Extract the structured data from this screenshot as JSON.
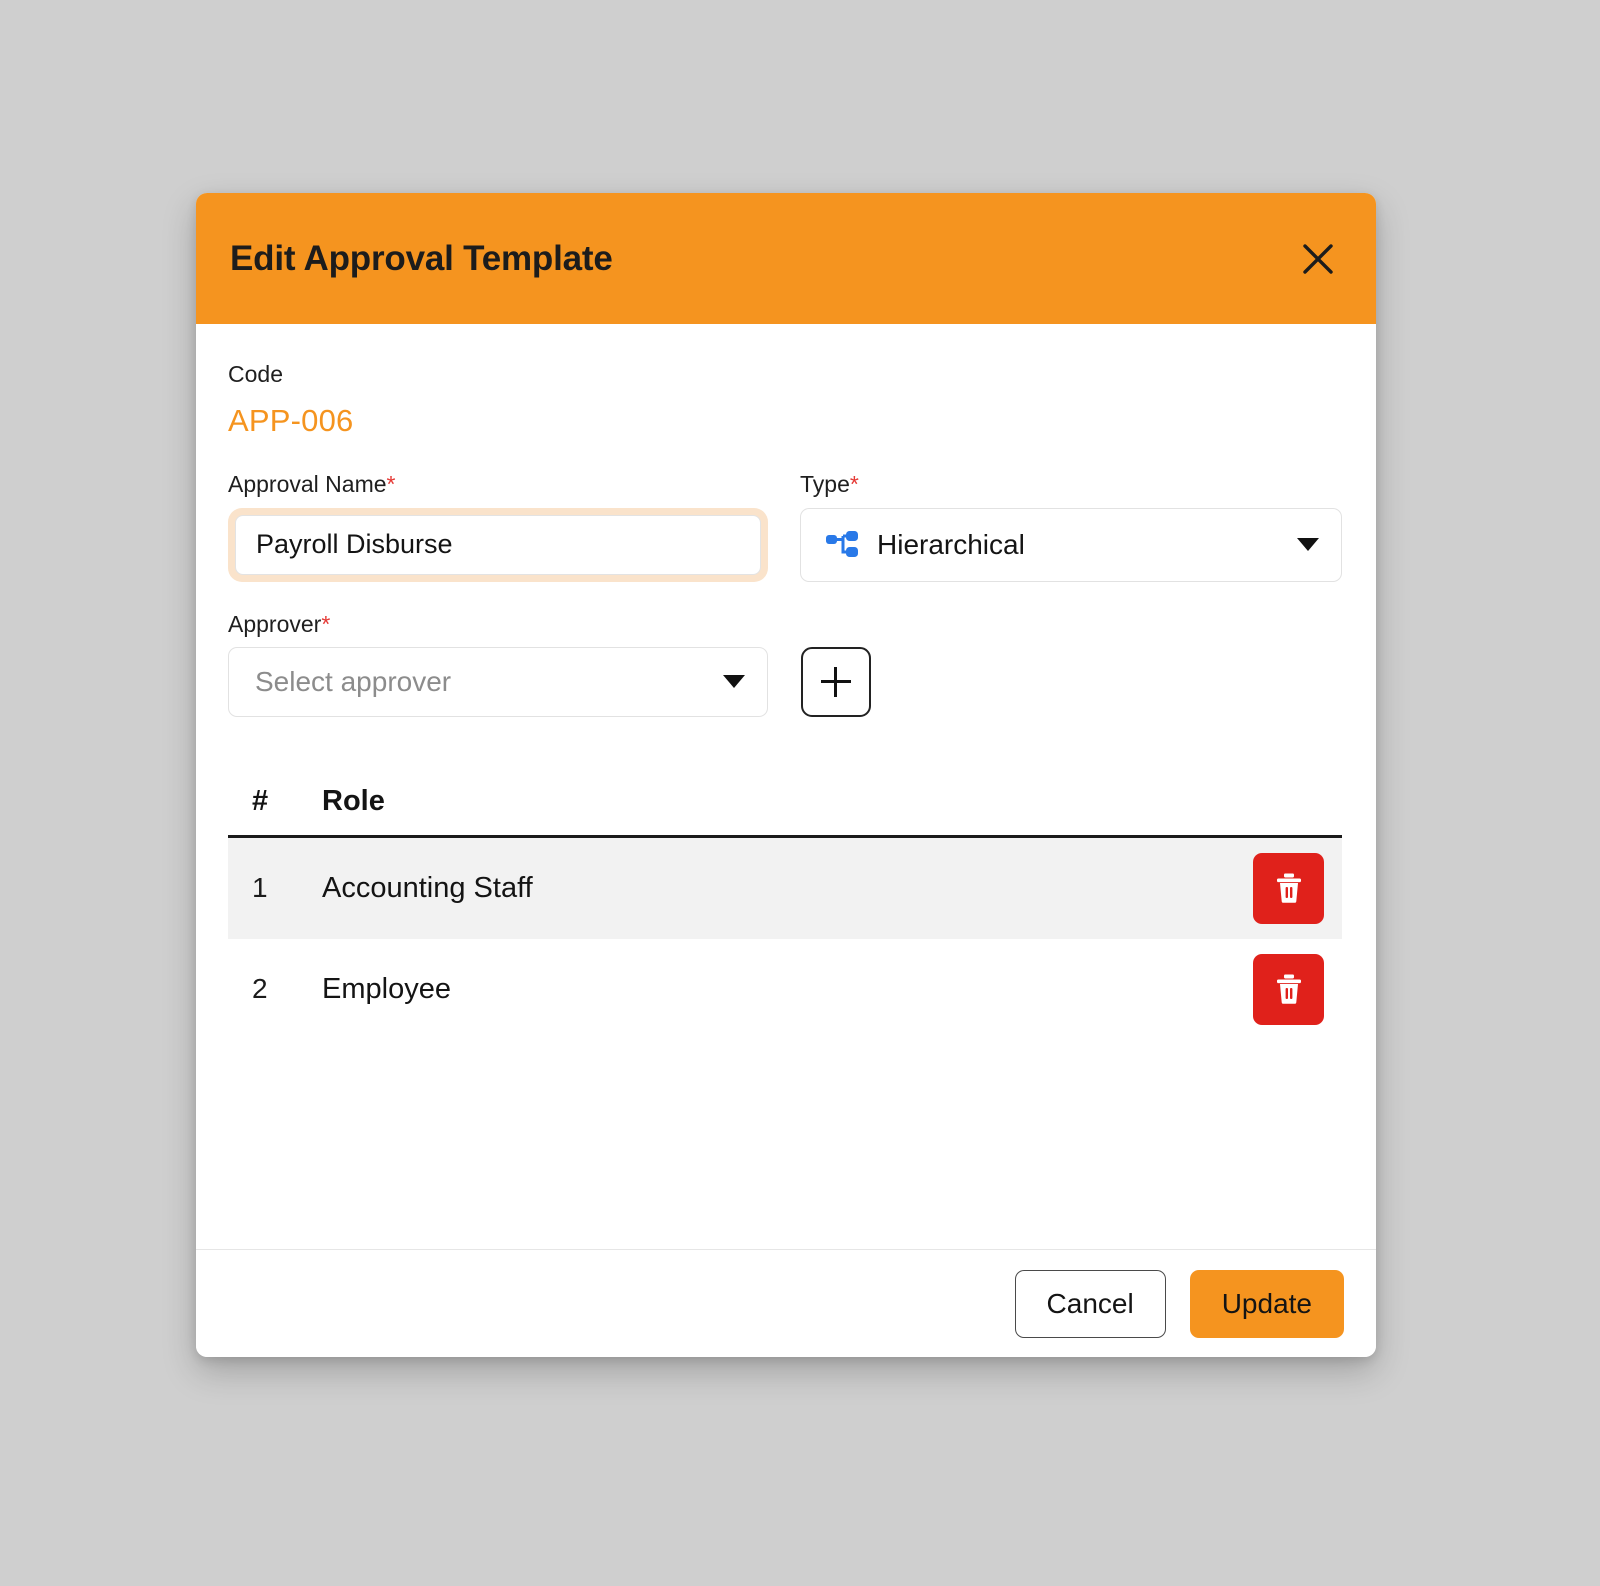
{
  "dialog": {
    "title": "Edit Approval Template",
    "close_icon": "close-icon"
  },
  "form": {
    "code_label": "Code",
    "code_value": "APP-006",
    "approval_name": {
      "label": "Approval Name",
      "required_marker": "*",
      "value": "Payroll Disburse",
      "placeholder": "Approval Name"
    },
    "type": {
      "label": "Type",
      "required_marker": "*",
      "selected": "Hierarchical",
      "icon": "hierarchy-icon",
      "caret_icon": "chevron-down-icon"
    },
    "approver": {
      "label": "Approver",
      "required_marker": "*",
      "selected": "",
      "placeholder": "Select approver",
      "caret_icon": "chevron-down-icon",
      "add_button_icon": "plus-icon"
    }
  },
  "table": {
    "columns": [
      "#",
      "Role"
    ],
    "rows": [
      {
        "num": "1",
        "role": "Accounting Staff",
        "delete_icon": "trash-icon"
      },
      {
        "num": "2",
        "role": "Employee",
        "delete_icon": "trash-icon"
      }
    ]
  },
  "footer": {
    "cancel_label": "Cancel",
    "update_label": "Update"
  },
  "colors": {
    "accent_orange": "#f5941f",
    "focus_ring": "#fae3cb",
    "danger_red": "#e0211b",
    "row_alt": "#f2f2f2",
    "page_bg": "#cfcfcf",
    "type_icon_blue": "#2979e8"
  }
}
